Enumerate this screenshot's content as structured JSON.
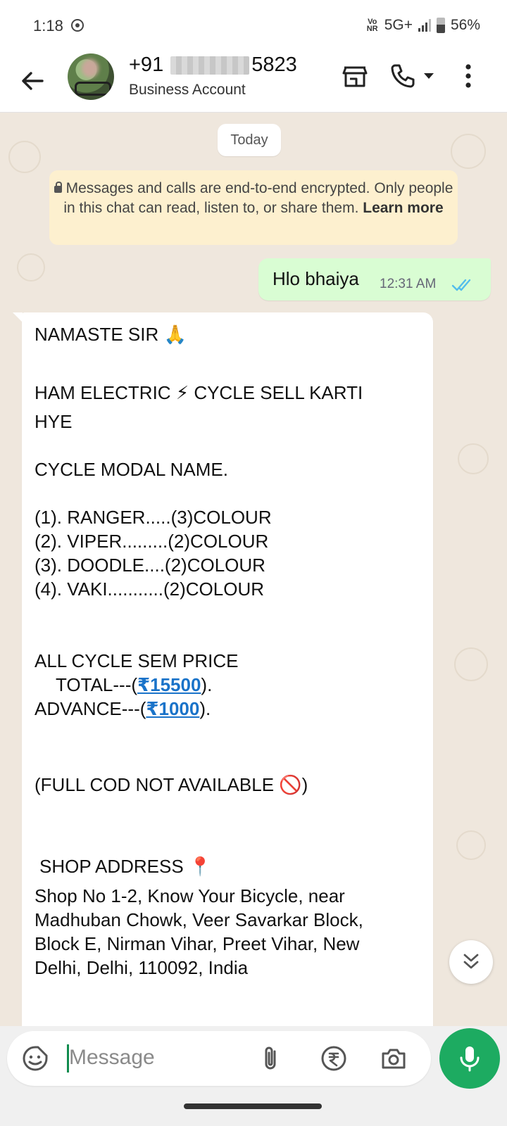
{
  "status_bar": {
    "time": "1:18",
    "network_badge": "Vo NR",
    "network": "5G+",
    "battery": "56%"
  },
  "header": {
    "title_prefix": "+91",
    "title_suffix": "5823",
    "subtitle": "Business Account",
    "icons": [
      "back-arrow-icon",
      "shop-icon",
      "phone-icon",
      "caret-down-icon",
      "more-vert-icon"
    ]
  },
  "chat": {
    "date_label": "Today",
    "encryption_notice": {
      "text": "Messages and calls are end-to-end encrypted. Only people in this chat can read, listen to, or share them.",
      "link": "Learn more"
    },
    "outgoing": {
      "text": "Hlo bhaiya",
      "time": "12:31 AM",
      "status": "read"
    },
    "incoming": {
      "greeting": "NAMASTE SIR",
      "greeting_emoji": "🙏",
      "line2_a": "HAM ELECTRIC",
      "line2_emoji": "⚡",
      "line2_b": "CYCLE SELL KARTI",
      "line3": "HYE",
      "models_heading": "CYCLE MODAL NAME.",
      "models": [
        "(1). RANGER.....(3)COLOUR",
        "(2). VIPER.........(2)COLOUR",
        "(3). DOODLE....(2)COLOUR",
        "(4). VAKI...........(2)COLOUR"
      ],
      "price_heading": "ALL CYCLE SEM PRICE",
      "total_prefix": "TOTAL---(",
      "total_amount": "₹15500",
      "total_suffix": ").",
      "advance_prefix": "ADVANCE---(",
      "advance_amount": "₹1000",
      "advance_suffix": ").",
      "cod_text": "(FULL COD NOT AVAILABLE",
      "cod_emoji": "🚫",
      "cod_close": ")",
      "address_heading": "SHOP ADDRESS",
      "address_emoji": "📍",
      "address_lines": [
        "Shop No 1-2, Know Your Bicycle, near",
        "Madhuban Chowk, Veer Savarkar Block,",
        "Block E, Nirman Vihar, Preet Vihar, New",
        "Delhi, Delhi, 110092, India"
      ]
    }
  },
  "composer": {
    "placeholder": "Message",
    "icons": [
      "sticker-icon",
      "attach-icon",
      "rupee-payment-icon",
      "camera-icon",
      "mic-icon"
    ]
  },
  "colors": {
    "accent_green": "#1dab61",
    "outgoing_bubble": "#d9fdd3",
    "chat_background": "#efe7dd",
    "link_blue": "#1a73c9",
    "read_ticks": "#53bdeb"
  }
}
